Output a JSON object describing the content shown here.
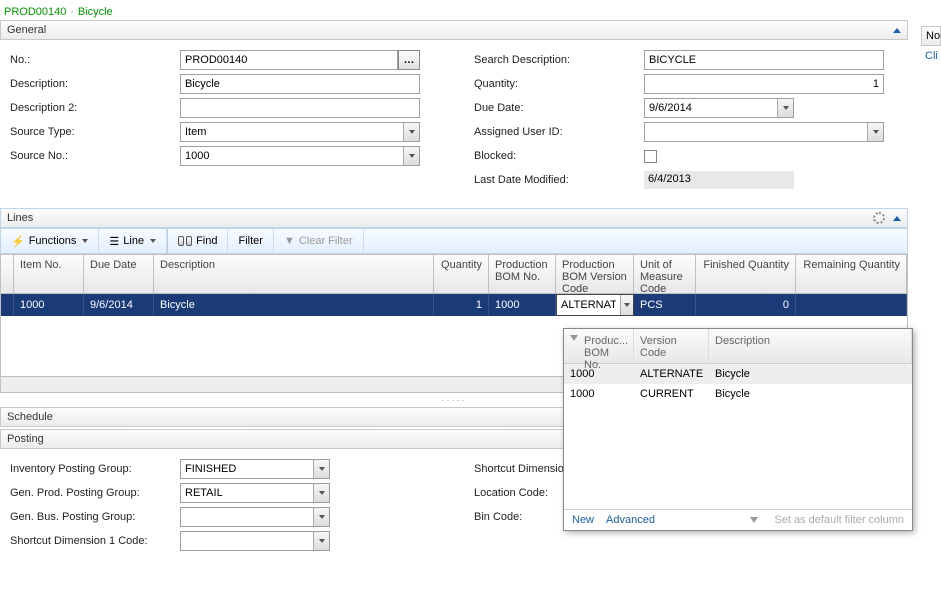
{
  "title": {
    "id": "PROD00140",
    "sep": "·",
    "name": "Bicycle"
  },
  "rightPane": {
    "label": "No",
    "link": "Cli"
  },
  "sections": {
    "general": "General",
    "lines": "Lines",
    "schedule": "Schedule",
    "posting": "Posting"
  },
  "general": {
    "left": {
      "no_label": "No.:",
      "no_value": "PROD00140",
      "desc_label": "Description:",
      "desc_value": "Bicycle",
      "desc2_label": "Description 2:",
      "desc2_value": "",
      "sourceType_label": "Source Type:",
      "sourceType_value": "Item",
      "sourceNo_label": "Source No.:",
      "sourceNo_value": "1000"
    },
    "right": {
      "searchDesc_label": "Search Description:",
      "searchDesc_value": "BICYCLE",
      "qty_label": "Quantity:",
      "qty_value": "1",
      "dueDate_label": "Due Date:",
      "dueDate_value": "9/6/2014",
      "assigned_label": "Assigned User ID:",
      "assigned_value": "",
      "blocked_label": "Blocked:",
      "lastMod_label": "Last Date Modified:",
      "lastMod_value": "6/4/2013"
    }
  },
  "toolbar": {
    "functions": "Functions",
    "line": "Line",
    "find": "Find",
    "filter": "Filter",
    "clearFilter": "Clear Filter"
  },
  "gridHeaders": {
    "itemNo": "Item No.",
    "dueDate": "Due Date",
    "description": "Description",
    "quantity": "Quantity",
    "prodBomNo": "Production BOM No.",
    "prodBomVer": "Production BOM Version Code",
    "uom": "Unit of Measure Code",
    "finQty": "Finished Quantity",
    "remQty": "Remaining Quantity"
  },
  "gridRow": {
    "itemNo": "1000",
    "dueDate": "9/6/2014",
    "description": "Bicycle",
    "quantity": "1",
    "prodBomNo": "1000",
    "prodBomVer": "ALTERNAT",
    "uom": "PCS",
    "finQty": "0",
    "remQty": ""
  },
  "lookup": {
    "headers": {
      "bomNo": "Produc... BOM No.",
      "verCode": "Version Code",
      "desc": "Description"
    },
    "rows": [
      {
        "bomNo": "1000",
        "ver": "ALTERNATE",
        "desc": "Bicycle"
      },
      {
        "bomNo": "1000",
        "ver": "CURRENT",
        "desc": "Bicycle"
      }
    ],
    "footer": {
      "new": "New",
      "advanced": "Advanced",
      "hint": "Set as default filter column"
    }
  },
  "posting": {
    "invGroup_label": "Inventory Posting Group:",
    "invGroup_value": "FINISHED",
    "genProd_label": "Gen. Prod. Posting Group:",
    "genProd_value": "RETAIL",
    "genBus_label": "Gen. Bus. Posting Group:",
    "genBus_value": "",
    "shortcut1_label": "Shortcut Dimension 1 Code:",
    "shortcut1_value": "",
    "shortcutDim_label": "Shortcut Dimension",
    "location_label": "Location Code:",
    "bin_label": "Bin Code:"
  }
}
